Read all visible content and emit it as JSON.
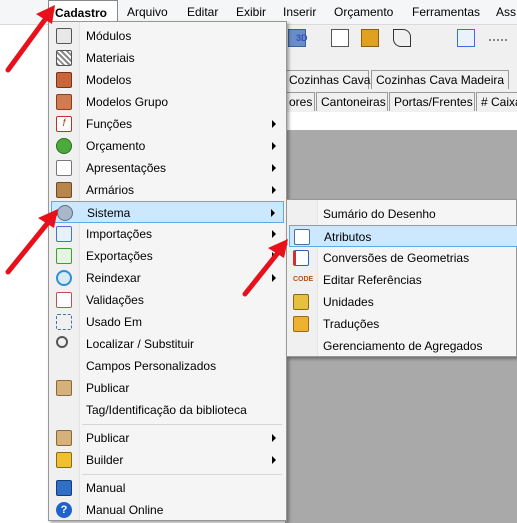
{
  "menubar": {
    "items": [
      "Cadastro",
      "Arquivo",
      "Editar",
      "Exibir",
      "Inserir",
      "Orçamento",
      "Ferramentas",
      "Ass"
    ]
  },
  "tabs_row1": [
    "Cozinhas Cava",
    "Cozinhas Cava Madeira"
  ],
  "tabs_row2": [
    "ores",
    "Cantoneiras",
    "Portas/Frentes",
    "# Caixa"
  ],
  "toolbar": {
    "icon_3d_label": "3D"
  },
  "menu": {
    "items": [
      {
        "label": "Módulos",
        "icon": "modules-icon"
      },
      {
        "label": "Materiais",
        "icon": "materials-icon"
      },
      {
        "label": "Modelos",
        "icon": "models-icon"
      },
      {
        "label": "Modelos Grupo",
        "icon": "models-group-icon"
      },
      {
        "label": "Funções",
        "icon": "functions-icon",
        "submenu": true
      },
      {
        "label": "Orçamento",
        "icon": "budget-icon",
        "submenu": true
      },
      {
        "label": "Apresentações",
        "icon": "presentations-icon",
        "submenu": true
      },
      {
        "label": "Armários",
        "icon": "cabinets-icon",
        "submenu": true
      },
      {
        "label": "Sistema",
        "icon": "system-gear-icon",
        "submenu": true,
        "highlighted": true
      },
      {
        "label": "Importações",
        "icon": "import-icon",
        "submenu": true
      },
      {
        "label": "Exportações",
        "icon": "export-icon",
        "submenu": true
      },
      {
        "label": "Reindexar",
        "icon": "reindex-icon",
        "submenu": true
      },
      {
        "label": "Validações",
        "icon": "validations-icon"
      },
      {
        "label": "Usado Em",
        "icon": "used-in-icon"
      },
      {
        "label": "Localizar / Substituir",
        "icon": "search-icon"
      },
      {
        "label": "Campos Personalizados",
        "icon": ""
      },
      {
        "label": "Publicar",
        "icon": "publish-icon"
      },
      {
        "label": "Tag/Identificação da biblioteca",
        "icon": ""
      },
      {
        "label": "Publicar",
        "icon": "publish-icon",
        "submenu": true
      },
      {
        "label": "Builder",
        "icon": "builder-icon",
        "submenu": true
      },
      {
        "label": "Manual",
        "icon": "manual-icon"
      },
      {
        "label": "Manual Online",
        "icon": "help-icon"
      }
    ]
  },
  "submenu": {
    "items": [
      {
        "label": "Sumário do Desenho",
        "icon": ""
      },
      {
        "label": "Atributos",
        "icon": "attributes-icon",
        "highlighted": true
      },
      {
        "label": "Conversões de Geometrias",
        "icon": "conversion-icon"
      },
      {
        "label": "Editar Referências",
        "icon": "code-icon"
      },
      {
        "label": "Unidades",
        "icon": "units-icon"
      },
      {
        "label": "Traduções",
        "icon": "translations-icon"
      },
      {
        "label": "Gerenciamento de Agregados",
        "icon": ""
      }
    ]
  },
  "colors": {
    "highlight_bg": "#cce8ff",
    "highlight_border": "#5ea9e8",
    "annotation_arrow": "#e8101b"
  }
}
